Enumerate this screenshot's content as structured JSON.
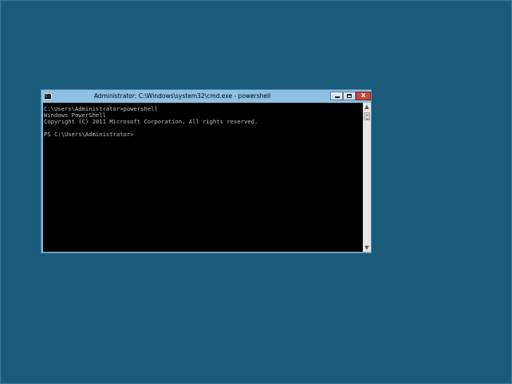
{
  "window": {
    "title": "Administrator: C:\\Windows\\system32\\cmd.exe - powershell",
    "icon": "cmd-icon",
    "icon_text": "C:\\",
    "close_label": "x"
  },
  "console": {
    "lines": [
      "C:\\Users\\Administrator>powershell",
      "Windows PowerShell",
      "Copyright (C) 2011 Microsoft Corporation. All rights reserved.",
      "",
      "PS C:\\Users\\Administrator>"
    ]
  },
  "scrollbar": {
    "up_arrow": "▲",
    "down_arrow": "▼"
  },
  "colors": {
    "desktop": "#1b5b7a",
    "titlebar": "#8dc0e3",
    "console_bg": "#000000",
    "console_text": "#c0c0c0",
    "close_button": "#c7463a"
  }
}
